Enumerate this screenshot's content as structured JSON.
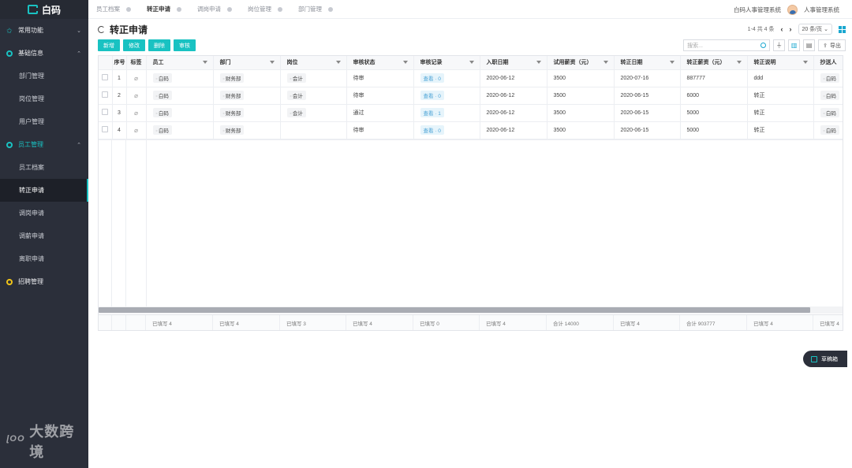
{
  "brand": {
    "name": "白码"
  },
  "sidebar": {
    "groups": [
      {
        "label": "常用功能",
        "chevron": "⌄",
        "icon": "star-icon",
        "items": []
      },
      {
        "label": "基础信息",
        "chevron": "⌃",
        "icon": "ring-icon",
        "items": [
          "部门管理",
          "岗位管理",
          "用户管理"
        ]
      },
      {
        "label": "员工管理",
        "chevron": "⌃",
        "icon": "ring-icon",
        "items": [
          "员工档案",
          "转正申请",
          "调岗申请",
          "调薪申请",
          "离职申请"
        ]
      },
      {
        "label": "招聘管理",
        "chevron": "",
        "icon": "ring-icon-yellow",
        "items": []
      }
    ],
    "g0": "常用功能",
    "g1": "基础信息",
    "g2": "员工管理",
    "g3": "招聘管理",
    "i1_0": "部门管理",
    "i1_1": "岗位管理",
    "i1_2": "用户管理",
    "i2_0": "员工档案",
    "i2_1": "转正申请",
    "i2_2": "调岗申请",
    "i2_3": "调薪申请",
    "i2_4": "离职申请"
  },
  "watermark": {
    "text": "大数跨境",
    "logo": "ᴵᴼᴼ"
  },
  "tabs": [
    "员工档案",
    "转正申请",
    "调岗申请",
    "岗位管理",
    "部门管理"
  ],
  "tab0": "员工档案",
  "tab1": "转正申请",
  "tab2": "调岗申请",
  "tab3": "岗位管理",
  "tab4": "部门管理",
  "header": {
    "system_name": "白码人事管理系统",
    "user_name": "人事管理系统"
  },
  "page": {
    "title": "转正申请",
    "pager_text": "1-4 共 4 条",
    "page_size": "20 条/页",
    "prev": "‹",
    "next": "›"
  },
  "toolbar": {
    "add": "新增",
    "edit": "修改",
    "delete": "删除",
    "review": "审核",
    "search_placeholder": "搜索...",
    "export": "导出"
  },
  "table": {
    "columns": [
      "序号",
      "标签",
      "员工",
      "部门",
      "岗位",
      "审核状态",
      "审核记录",
      "入职日期",
      "试用薪资（元）",
      "转正日期",
      "转正薪资（元）",
      "转正说明",
      "抄送人"
    ],
    "rows": [
      {
        "no": "1",
        "employee": "白码",
        "dept": "财务部",
        "position": "会计",
        "status": "待审",
        "record": "查看 · 0",
        "join": "2020-06-12",
        "trial": "3500",
        "regular_date": "2020-07-16",
        "regular_salary": "887777",
        "note": "ddd",
        "cc": "白码"
      },
      {
        "no": "2",
        "employee": "白码",
        "dept": "财务部",
        "position": "会计",
        "status": "待审",
        "record": "查看 · 0",
        "join": "2020-06-12",
        "trial": "3500",
        "regular_date": "2020-06-15",
        "regular_salary": "6000",
        "note": "转正",
        "cc": "白码"
      },
      {
        "no": "3",
        "employee": "白码",
        "dept": "财务部",
        "position": "会计",
        "status": "通过",
        "record": "查看 · 1",
        "join": "2020-06-12",
        "trial": "3500",
        "regular_date": "2020-06-15",
        "regular_salary": "5000",
        "note": "转正",
        "cc": "白码"
      },
      {
        "no": "4",
        "employee": "白码",
        "dept": "财务部",
        "position": "",
        "status": "待审",
        "record": "查看 · 0",
        "join": "2020-06-12",
        "trial": "3500",
        "regular_date": "2020-06-15",
        "regular_salary": "5000",
        "note": "转正",
        "cc": "白码"
      }
    ],
    "footer": [
      "已填写 4",
      "已填写 4",
      "已填写 3",
      "已填写 4",
      "已填写 0",
      "已填写 4",
      "合计 14000",
      "已填写 4",
      "合计 903777",
      "已填写 4",
      "已填写 4"
    ]
  },
  "draft_button": "草稿箱",
  "colors": {
    "accent": "#19c2c2",
    "sidebar": "#2b2f3a",
    "link": "#4ba3d6"
  }
}
